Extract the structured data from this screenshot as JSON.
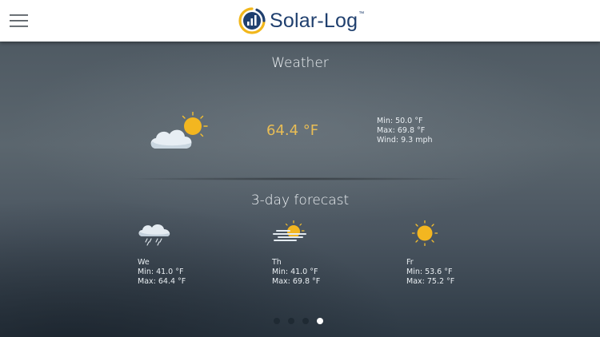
{
  "header": {
    "logo_text": "Solar-Log",
    "logo_tm": "™",
    "menu_icon": "hamburger-menu-icon",
    "logo_color": "#1f3f6e",
    "logo_accent": "#f2b71b"
  },
  "weather": {
    "title": "Weather",
    "icon": "partly-cloudy-icon",
    "temperature": "64.4 °F",
    "min": "Min: 50.0 °F",
    "max": "Max: 69.8 °F",
    "wind": "Wind: 9.3 mph",
    "temp_color": "#e9bd55"
  },
  "forecast": {
    "title": "3-day forecast",
    "days": [
      {
        "day": "We",
        "min": "Min: 41.0 °F",
        "max": "Max: 64.4 °F",
        "icon": "rain-cloud-icon"
      },
      {
        "day": "Th",
        "min": "Min: 41.0 °F",
        "max": "Max: 69.8 °F",
        "icon": "fog-sun-icon"
      },
      {
        "day": "Fr",
        "min": "Min: 53.6 °F",
        "max": "Max: 75.2 °F",
        "icon": "sun-icon"
      }
    ]
  },
  "pager": {
    "count": 4,
    "active_index": 3
  }
}
